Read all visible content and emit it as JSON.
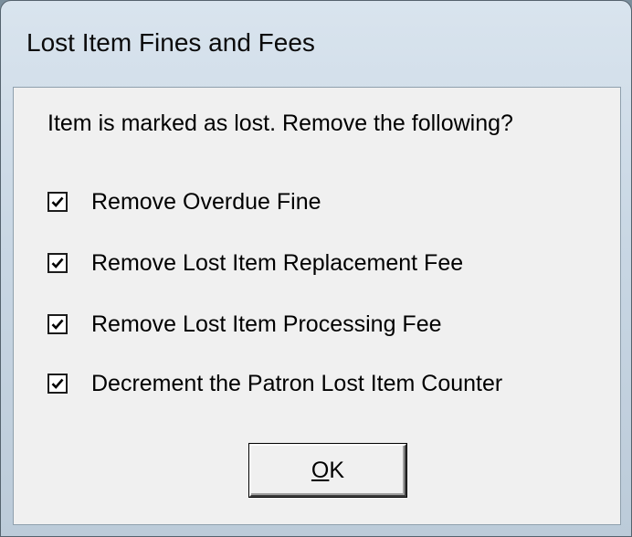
{
  "window": {
    "title": "Lost Item Fines and Fees"
  },
  "dialog": {
    "prompt": "Item is marked as lost. Remove the following?",
    "options": [
      {
        "label": "Remove Overdue Fine",
        "checked": true
      },
      {
        "label": "Remove Lost Item Replacement Fee",
        "checked": true
      },
      {
        "label": "Remove Lost Item Processing Fee",
        "checked": true
      },
      {
        "label": "Decrement the Patron Lost Item Counter",
        "checked": true
      }
    ],
    "ok_button": {
      "mnemonic": "O",
      "rest": "K"
    }
  },
  "icons": {
    "checkbox_mark": "checkmark-icon"
  }
}
